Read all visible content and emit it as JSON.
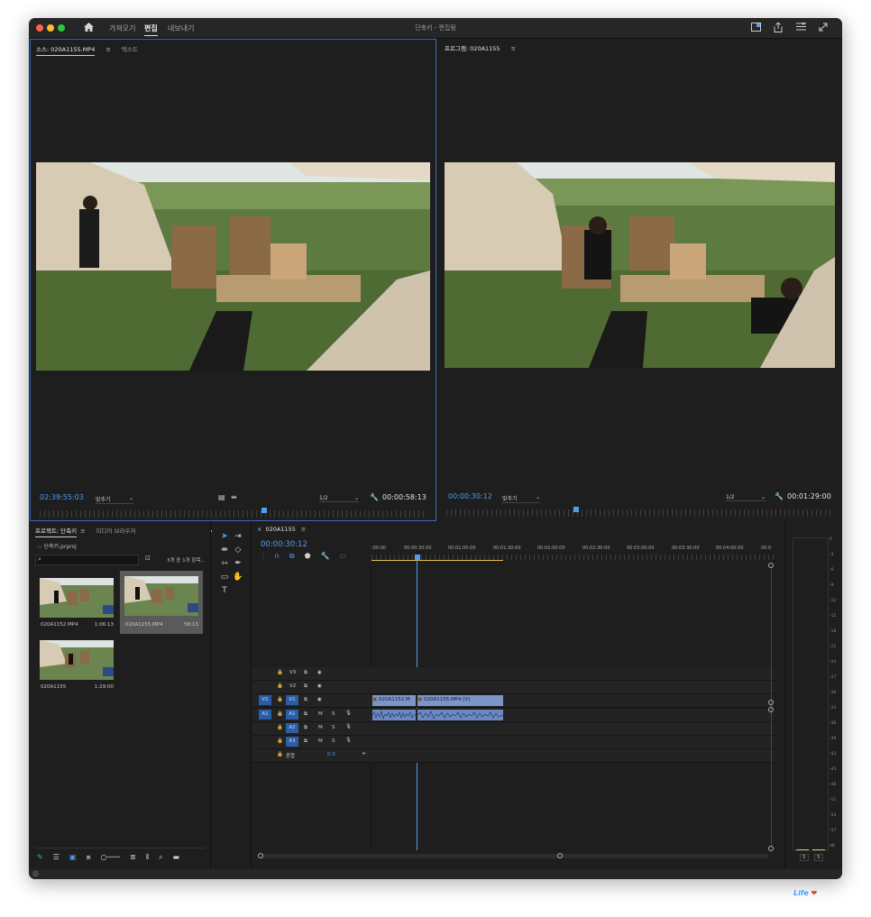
{
  "titlebar": {
    "nav": [
      "가져오기",
      "편집",
      "내보내기"
    ],
    "active_nav": "편집",
    "title": "단축키 - 편집됨"
  },
  "source": {
    "tabs": [
      "소스: 020A1155.MP4",
      "텍스트"
    ],
    "timecode": "02:39:55:03",
    "fit": "맞추기",
    "resolution": "1/2",
    "duration": "00:00:58:13"
  },
  "program": {
    "tab": "프로그램: 020A1155",
    "timecode": "00:00:30:12",
    "fit": "맞추기",
    "resolution": "1/2",
    "duration": "00:01:29:00"
  },
  "project": {
    "tabs": [
      "프로젝트: 단축키",
      "미디어 브라우저"
    ],
    "file": "단축키.prproj",
    "selection_info": "3개 중 1개 항목...",
    "items": [
      {
        "name": "020A1152.MP4",
        "duration": "1:06:13"
      },
      {
        "name": "020A1155.MP4",
        "duration": "58:13"
      },
      {
        "name": "020A1155",
        "duration": "1:29:00"
      }
    ]
  },
  "timeline": {
    "tab": "020A1155",
    "timecode": "00:00:30:12",
    "ruler": [
      ":00:00",
      "00:00:30:00",
      "00:01:00:00",
      "00:01:30:00",
      "00:02:00:00",
      "00:02:30:00",
      "00:03:00:00",
      "00:03:30:00",
      "00:04:00:00",
      "00:0"
    ],
    "video_tracks": [
      "V3",
      "V2",
      "V1"
    ],
    "audio_tracks": [
      "A1",
      "A2",
      "A3"
    ],
    "source_patch_v": "V1",
    "source_patch_a": "A1",
    "mix_label": "혼합",
    "mix_value": "0.0",
    "clips": [
      "020A1152.M",
      "020A1155.MP4 [V]"
    ]
  },
  "meter": {
    "scale": [
      "0",
      "-3",
      "-6",
      "-9",
      "-12",
      "-15",
      "-18",
      "-21",
      "-24",
      "-27",
      "-30",
      "-33",
      "-36",
      "-39",
      "-42",
      "-45",
      "-48",
      "-51",
      "-54",
      "-57",
      "dB"
    ],
    "solo": [
      "S",
      "S"
    ]
  },
  "watermark": "Life"
}
